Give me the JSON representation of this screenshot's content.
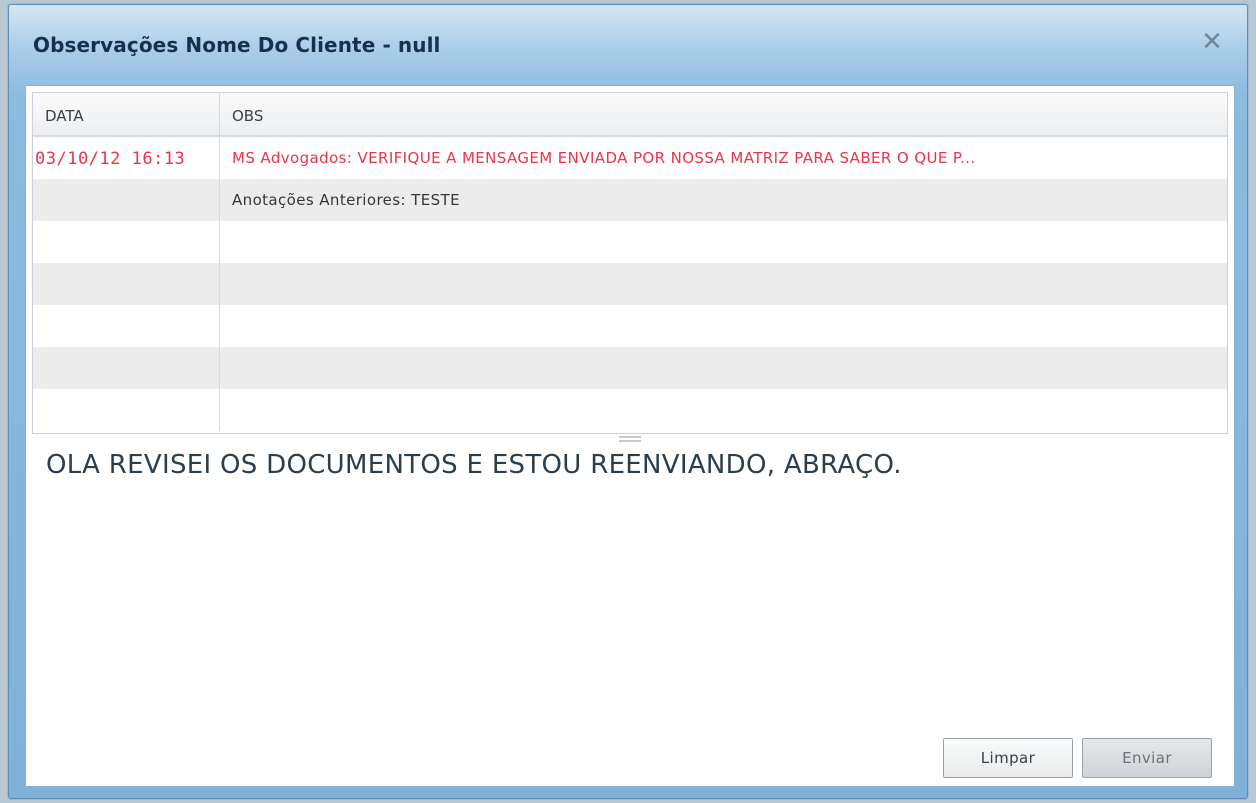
{
  "dialog": {
    "title": "Observações Nome Do Cliente - null",
    "close_icon": "close-icon",
    "close_glyph": "✕"
  },
  "grid": {
    "columns": [
      "DATA",
      "OBS"
    ],
    "rows": [
      {
        "data": "03/10/12  16:13",
        "obs": "MS Advogados: VERIFIQUE A MENSAGEM ENVIADA POR  NOSSA MATRIZ PARA SABER O QUE P...",
        "color": "#e8354b"
      },
      {
        "data": "",
        "obs": "Anotações Anteriores: TESTE",
        "color": "#33383d"
      },
      {
        "data": "",
        "obs": "",
        "color": ""
      },
      {
        "data": "",
        "obs": "",
        "color": ""
      },
      {
        "data": "",
        "obs": "",
        "color": ""
      },
      {
        "data": "",
        "obs": "",
        "color": ""
      },
      {
        "data": "",
        "obs": "",
        "color": ""
      }
    ]
  },
  "message": {
    "value": "OLA REVISEI OS DOCUMENTOS E ESTOU REENVIANDO, ABRAÇO."
  },
  "buttons": {
    "clear": "Limpar",
    "send": "Enviar"
  },
  "colors": {
    "title_bar": "#8bbbdf",
    "highlight_text": "#e8354b",
    "row_alt": "#ececec"
  }
}
